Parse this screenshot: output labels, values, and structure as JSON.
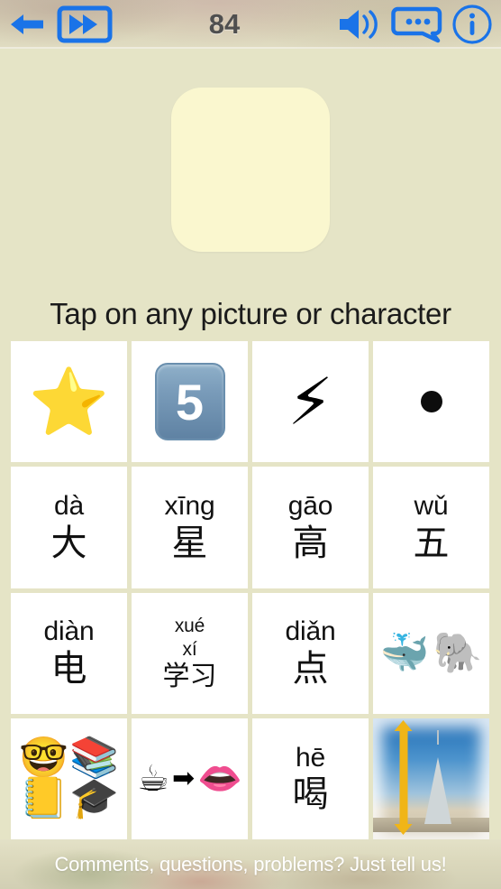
{
  "topbar": {
    "back_icon": "arrow-left-icon",
    "next_icon": "fast-forward-icon",
    "score": "84",
    "sound_icon": "speaker-icon",
    "comment_icon": "comment-bubble-icon",
    "info_icon": "info-circle-icon",
    "icon_color": "#1a73e8",
    "score_color": "#4f4f4f"
  },
  "prompt": {
    "card_color": "#faf7cf",
    "card_content": ""
  },
  "instruction": {
    "text": "Tap on any picture or character"
  },
  "grid": {
    "columns": 4,
    "rows": 4,
    "cells": [
      {
        "id": "cell-r1c1",
        "kind": "emoji",
        "name": "star-emoji",
        "glyph": "⭐"
      },
      {
        "id": "cell-r1c2",
        "kind": "keycap",
        "name": "keycap-five",
        "glyph": "5"
      },
      {
        "id": "cell-r1c3",
        "kind": "emoji",
        "name": "high-voltage-emoji",
        "glyph": "⚡"
      },
      {
        "id": "cell-r1c4",
        "kind": "dot",
        "name": "black-dot",
        "glyph": "●"
      },
      {
        "id": "cell-r2c1",
        "kind": "word",
        "name": "word-da",
        "pinyin": "dà",
        "hanzi": "大"
      },
      {
        "id": "cell-r2c2",
        "kind": "word",
        "name": "word-xing",
        "pinyin": "xīng",
        "hanzi": "星"
      },
      {
        "id": "cell-r2c3",
        "kind": "word",
        "name": "word-gao",
        "pinyin": "gāo",
        "hanzi": "高"
      },
      {
        "id": "cell-r2c4",
        "kind": "word",
        "name": "word-wu",
        "pinyin": "wǔ",
        "hanzi": "五"
      },
      {
        "id": "cell-r3c1",
        "kind": "word",
        "name": "word-dian-electric",
        "pinyin": "diàn",
        "hanzi": "电"
      },
      {
        "id": "cell-r3c2",
        "kind": "word2",
        "name": "word-xuexi",
        "pinyin1": "xué",
        "pinyin2": "xí",
        "hanzi": "学习"
      },
      {
        "id": "cell-r3c3",
        "kind": "word",
        "name": "word-dian-dot",
        "pinyin": "diǎn",
        "hanzi": "点"
      },
      {
        "id": "cell-r3c4",
        "kind": "animals",
        "name": "whale-elephant-emoji",
        "glyph1": "🐳",
        "glyph2": "🐘"
      },
      {
        "id": "cell-r4c1",
        "kind": "quad",
        "name": "study-emoji-group",
        "glyph1": "🤓",
        "glyph2": "📚",
        "glyph3": "📒",
        "glyph4": "🎓"
      },
      {
        "id": "cell-r4c2",
        "kind": "sequence",
        "name": "drink-emoji-sequence",
        "glyph1": "☕",
        "arrow": "➡",
        "glyph2": "👄"
      },
      {
        "id": "cell-r4c3",
        "kind": "word",
        "name": "word-he-drink",
        "pinyin": "hē",
        "hanzi": "喝"
      },
      {
        "id": "cell-r4c4",
        "kind": "photo",
        "name": "tall-building-photo",
        "caption": ""
      }
    ]
  },
  "footer": {
    "text": "Comments, questions, problems? Just tell us!",
    "text_color": "#ffffff"
  }
}
